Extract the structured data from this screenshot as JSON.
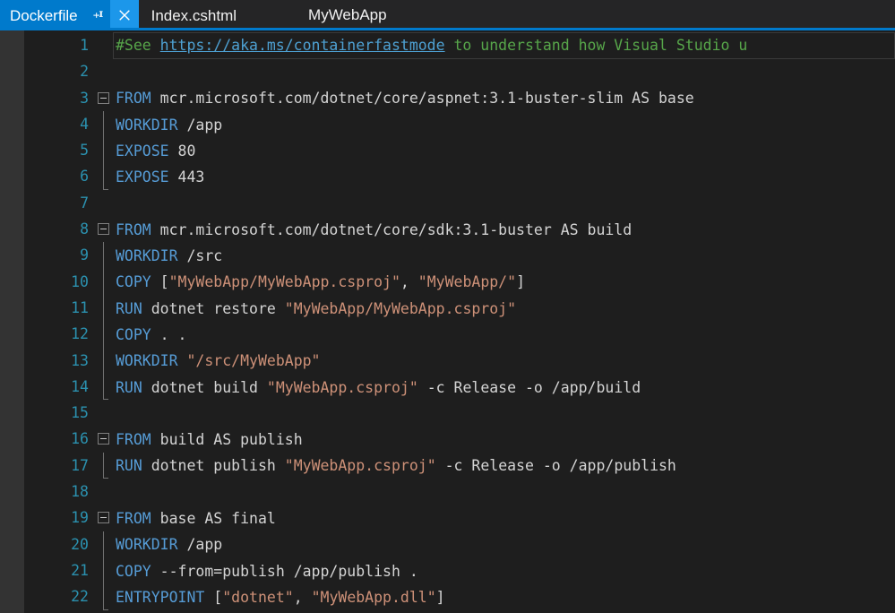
{
  "tabstrip": {
    "active_tab": {
      "label": "Dockerfile",
      "pin_icon": "pin-icon",
      "close_icon": "close-icon",
      "accent_color": "#007acc",
      "close_hover_color": "#1c97ea"
    },
    "inactive_tabs": [
      {
        "label": "Index.cshtml"
      }
    ],
    "project_label": "MyWebApp",
    "underline_color": "#007acc"
  },
  "editor": {
    "language": "dockerfile",
    "background": "#1e1e1e",
    "gutter_color": "#2b91af",
    "colors": {
      "keyword": "#569cd6",
      "string": "#ce9178",
      "comment": "#57a64a",
      "plain": "#d4d4d4",
      "hyperlink": "#4ea1d3",
      "fold_marker": "#808080",
      "indicator_margin": "#333333"
    },
    "lines": [
      {
        "n": "1",
        "current": true,
        "fold": "none",
        "tokens": [
          {
            "t": "cmt",
            "s": "#See "
          },
          {
            "t": "link",
            "s": "https://aka.ms/containerfastmode"
          },
          {
            "t": "cmt",
            "s": " to understand how Visual Studio u"
          }
        ]
      },
      {
        "n": "2",
        "fold": "none",
        "tokens": []
      },
      {
        "n": "3",
        "fold": "box",
        "tokens": [
          {
            "t": "kw",
            "s": "FROM"
          },
          {
            "t": "plain",
            "s": " mcr.microsoft.com/dotnet/core/aspnet:3.1-buster-slim AS base"
          }
        ]
      },
      {
        "n": "4",
        "fold": "line",
        "tokens": [
          {
            "t": "kw",
            "s": "WORKDIR"
          },
          {
            "t": "plain",
            "s": " /app"
          }
        ]
      },
      {
        "n": "5",
        "fold": "line",
        "tokens": [
          {
            "t": "kw",
            "s": "EXPOSE"
          },
          {
            "t": "plain",
            "s": " 80"
          }
        ]
      },
      {
        "n": "6",
        "fold": "foot",
        "tokens": [
          {
            "t": "kw",
            "s": "EXPOSE"
          },
          {
            "t": "plain",
            "s": " 443"
          }
        ]
      },
      {
        "n": "7",
        "fold": "none",
        "tokens": []
      },
      {
        "n": "8",
        "fold": "box",
        "tokens": [
          {
            "t": "kw",
            "s": "FROM"
          },
          {
            "t": "plain",
            "s": " mcr.microsoft.com/dotnet/core/sdk:3.1-buster AS build"
          }
        ]
      },
      {
        "n": "9",
        "fold": "line",
        "tokens": [
          {
            "t": "kw",
            "s": "WORKDIR"
          },
          {
            "t": "plain",
            "s": " /src"
          }
        ]
      },
      {
        "n": "10",
        "fold": "line",
        "tokens": [
          {
            "t": "kw",
            "s": "COPY"
          },
          {
            "t": "plain",
            "s": " ["
          },
          {
            "t": "str",
            "s": "\"MyWebApp/MyWebApp.csproj\""
          },
          {
            "t": "plain",
            "s": ", "
          },
          {
            "t": "str",
            "s": "\"MyWebApp/\""
          },
          {
            "t": "plain",
            "s": "]"
          }
        ]
      },
      {
        "n": "11",
        "fold": "line",
        "tokens": [
          {
            "t": "kw",
            "s": "RUN"
          },
          {
            "t": "plain",
            "s": " dotnet restore "
          },
          {
            "t": "str",
            "s": "\"MyWebApp/MyWebApp.csproj\""
          }
        ]
      },
      {
        "n": "12",
        "fold": "line",
        "tokens": [
          {
            "t": "kw",
            "s": "COPY"
          },
          {
            "t": "plain",
            "s": " . ."
          }
        ]
      },
      {
        "n": "13",
        "fold": "line",
        "tokens": [
          {
            "t": "kw",
            "s": "WORKDIR"
          },
          {
            "t": "plain",
            "s": " "
          },
          {
            "t": "str",
            "s": "\"/src/MyWebApp\""
          }
        ]
      },
      {
        "n": "14",
        "fold": "foot",
        "tokens": [
          {
            "t": "kw",
            "s": "RUN"
          },
          {
            "t": "plain",
            "s": " dotnet build "
          },
          {
            "t": "str",
            "s": "\"MyWebApp.csproj\""
          },
          {
            "t": "plain",
            "s": " -c Release -o /app/build"
          }
        ]
      },
      {
        "n": "15",
        "fold": "none",
        "tokens": []
      },
      {
        "n": "16",
        "fold": "box",
        "tokens": [
          {
            "t": "kw",
            "s": "FROM"
          },
          {
            "t": "plain",
            "s": " build AS publish"
          }
        ]
      },
      {
        "n": "17",
        "fold": "foot",
        "tokens": [
          {
            "t": "kw",
            "s": "RUN"
          },
          {
            "t": "plain",
            "s": " dotnet publish "
          },
          {
            "t": "str",
            "s": "\"MyWebApp.csproj\""
          },
          {
            "t": "plain",
            "s": " -c Release -o /app/publish"
          }
        ]
      },
      {
        "n": "18",
        "fold": "none",
        "tokens": []
      },
      {
        "n": "19",
        "fold": "box",
        "tokens": [
          {
            "t": "kw",
            "s": "FROM"
          },
          {
            "t": "plain",
            "s": " base AS final"
          }
        ]
      },
      {
        "n": "20",
        "fold": "line",
        "tokens": [
          {
            "t": "kw",
            "s": "WORKDIR"
          },
          {
            "t": "plain",
            "s": " /app"
          }
        ]
      },
      {
        "n": "21",
        "fold": "line",
        "tokens": [
          {
            "t": "kw",
            "s": "COPY"
          },
          {
            "t": "plain",
            "s": " --from=publish /app/publish ."
          }
        ]
      },
      {
        "n": "22",
        "fold": "foot",
        "tokens": [
          {
            "t": "kw",
            "s": "ENTRYPOINT"
          },
          {
            "t": "plain",
            "s": " ["
          },
          {
            "t": "str",
            "s": "\"dotnet\""
          },
          {
            "t": "plain",
            "s": ", "
          },
          {
            "t": "str",
            "s": "\"MyWebApp.dll\""
          },
          {
            "t": "plain",
            "s": "]"
          }
        ]
      }
    ]
  }
}
